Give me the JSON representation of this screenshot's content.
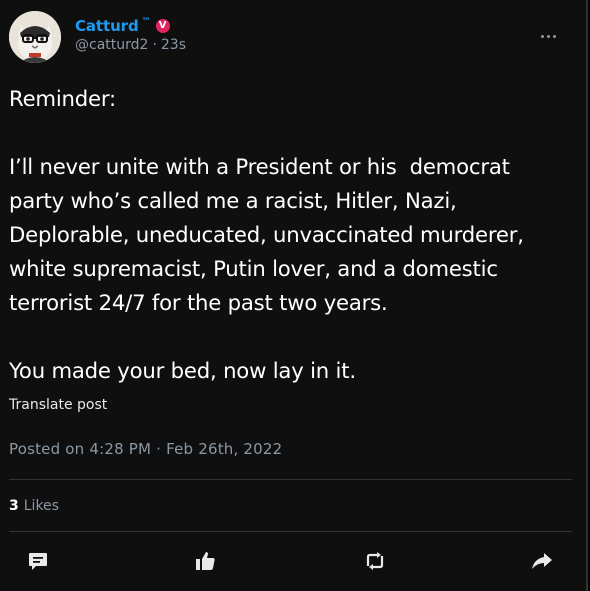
{
  "tweet": {
    "author": {
      "display_name": "Catturd",
      "trademark": "™",
      "badge": "V",
      "badge_color": "#e0245e",
      "handle": "@catturd2",
      "separator": "·",
      "time_ago": "23s"
    },
    "more_icon": "more-dots-icon",
    "text": {
      "line1": "Reminder:",
      "paragraph2": "I’ll never unite with a President or his  democrat party who’s called me a racist, Hitler, Nazi, Deplorable, uneducated, unvaccinated murderer, white supremacist, Putin lover, and a domestic terrorist 24/7 for the past two years.",
      "paragraph3": "You made your bed, now lay in it."
    },
    "translate_label": "Translate post",
    "posted_label": "Posted on 4:28 PM · Feb 26th, 2022",
    "likes": {
      "count": "3",
      "label": "Likes"
    },
    "actions": [
      {
        "icon": "comment-icon"
      },
      {
        "icon": "like-icon"
      },
      {
        "icon": "retweet-icon"
      },
      {
        "icon": "share-icon"
      }
    ]
  },
  "colors": {
    "accent": "#1d9bf0",
    "muted": "#8b98a5",
    "text": "#ffffff",
    "background": "#0f0f10",
    "divider": "#2f3336"
  }
}
